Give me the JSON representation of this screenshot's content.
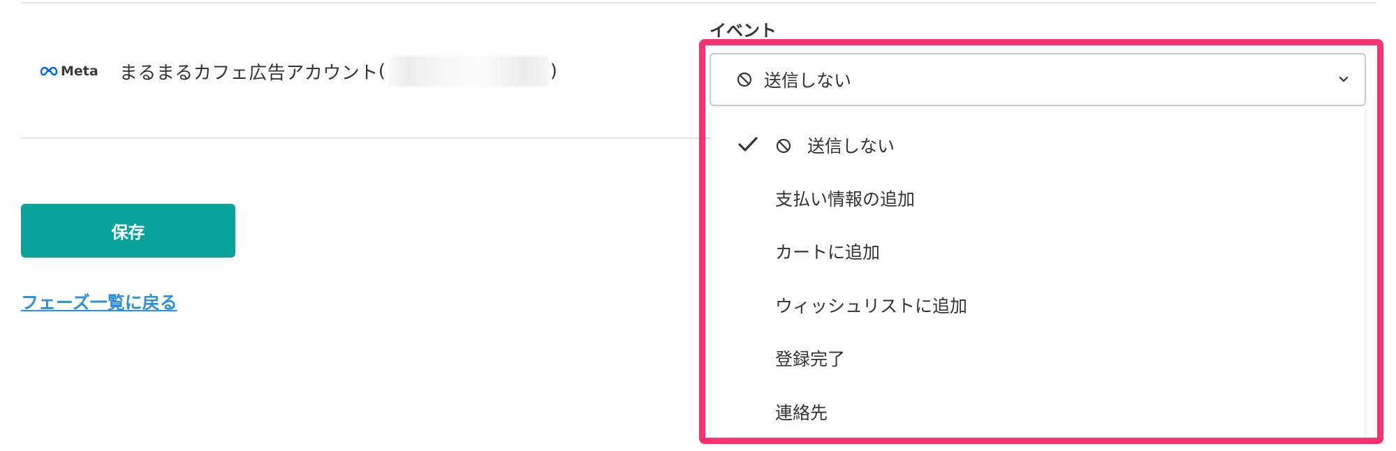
{
  "account": {
    "brand": "Meta",
    "name": "まるまるカフェ広告アカウント",
    "open_paren": "(",
    "close_paren": ")"
  },
  "actions": {
    "save_label": "保存",
    "back_link_label": "フェーズ一覧に戻る"
  },
  "event": {
    "label": "イベント",
    "selected_value": "送信しない",
    "options": [
      {
        "label": "送信しない",
        "selected": true
      },
      {
        "label": "支払い情報の追加",
        "selected": false
      },
      {
        "label": "カートに追加",
        "selected": false
      },
      {
        "label": "ウィッシュリストに追加",
        "selected": false
      },
      {
        "label": "登録完了",
        "selected": false
      },
      {
        "label": "連絡先",
        "selected": false
      }
    ]
  },
  "colors": {
    "accent": "#08a39a",
    "link": "#2f8fd8",
    "highlight": "#f6336f",
    "meta_blue": "#0467df"
  },
  "icons": {
    "brand_logo": "meta-infinity-icon",
    "no_send": "prohibited-icon",
    "dropdown": "chevron-down-icon",
    "selected_mark": "checkmark-icon"
  }
}
